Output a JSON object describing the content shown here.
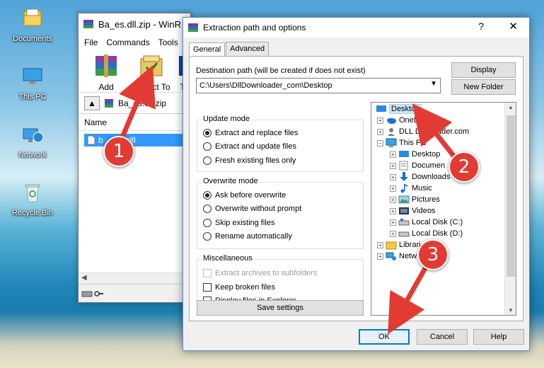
{
  "desktop": {
    "icons": [
      {
        "label": "Documents"
      },
      {
        "label": "This PC"
      },
      {
        "label": "Network"
      },
      {
        "label": "Recycle Bin"
      }
    ]
  },
  "winrar": {
    "title": "Ba_es.dll.zip - WinR",
    "menu": [
      "File",
      "Commands",
      "Tools"
    ],
    "toolbar": {
      "add": "Add",
      "extract": "Extract To",
      "third": "T"
    },
    "path": "Ba_es.dll.zip",
    "column_name": "Name",
    "file": "b",
    "file_tail": "dll"
  },
  "dialog": {
    "title": "Extraction path and options",
    "help_glyph": "?",
    "close_glyph": "✕",
    "tabs": [
      "General",
      "Advanced"
    ],
    "dest_label": "Destination path (will be created if does not exist)",
    "dest_value": "C:\\Users\\DllDownloader_com\\Desktop",
    "display_btn": "Display",
    "new_folder_btn": "New Folder",
    "update_mode": {
      "title": "Update mode",
      "options": [
        "Extract and replace files",
        "Extract and update files",
        "Fresh existing files only"
      ],
      "selected": 0
    },
    "overwrite_mode": {
      "title": "Overwrite mode",
      "options": [
        "Ask before overwrite",
        "Overwrite without prompt",
        "Skip existing files",
        "Rename automatically"
      ],
      "selected": 0
    },
    "misc": {
      "title": "Miscellaneous",
      "options": [
        "Extract archives to subfolders",
        "Keep broken files",
        "Display files in Explorer"
      ]
    },
    "save_settings": "Save settings",
    "tree": {
      "desktop": "Desktop",
      "onedrive": "OneD",
      "dll": "DLL Dow",
      "dll_tail": "nader.com",
      "thispc": "This PC",
      "desktop2": "Desktop",
      "documents": "Documen",
      "downloads": "Downloads",
      "music": "Music",
      "pictures": "Pictures",
      "videos": "Videos",
      "local_c": "Local Disk (C:)",
      "local_d": "Local Disk (D:)",
      "libraries": "Librari",
      "network": "Netw"
    },
    "ok": "OK",
    "cancel": "Cancel",
    "help": "Help"
  },
  "annotations": {
    "b1": "1",
    "b2": "2",
    "b3": "3",
    "color": "#e23b33"
  }
}
